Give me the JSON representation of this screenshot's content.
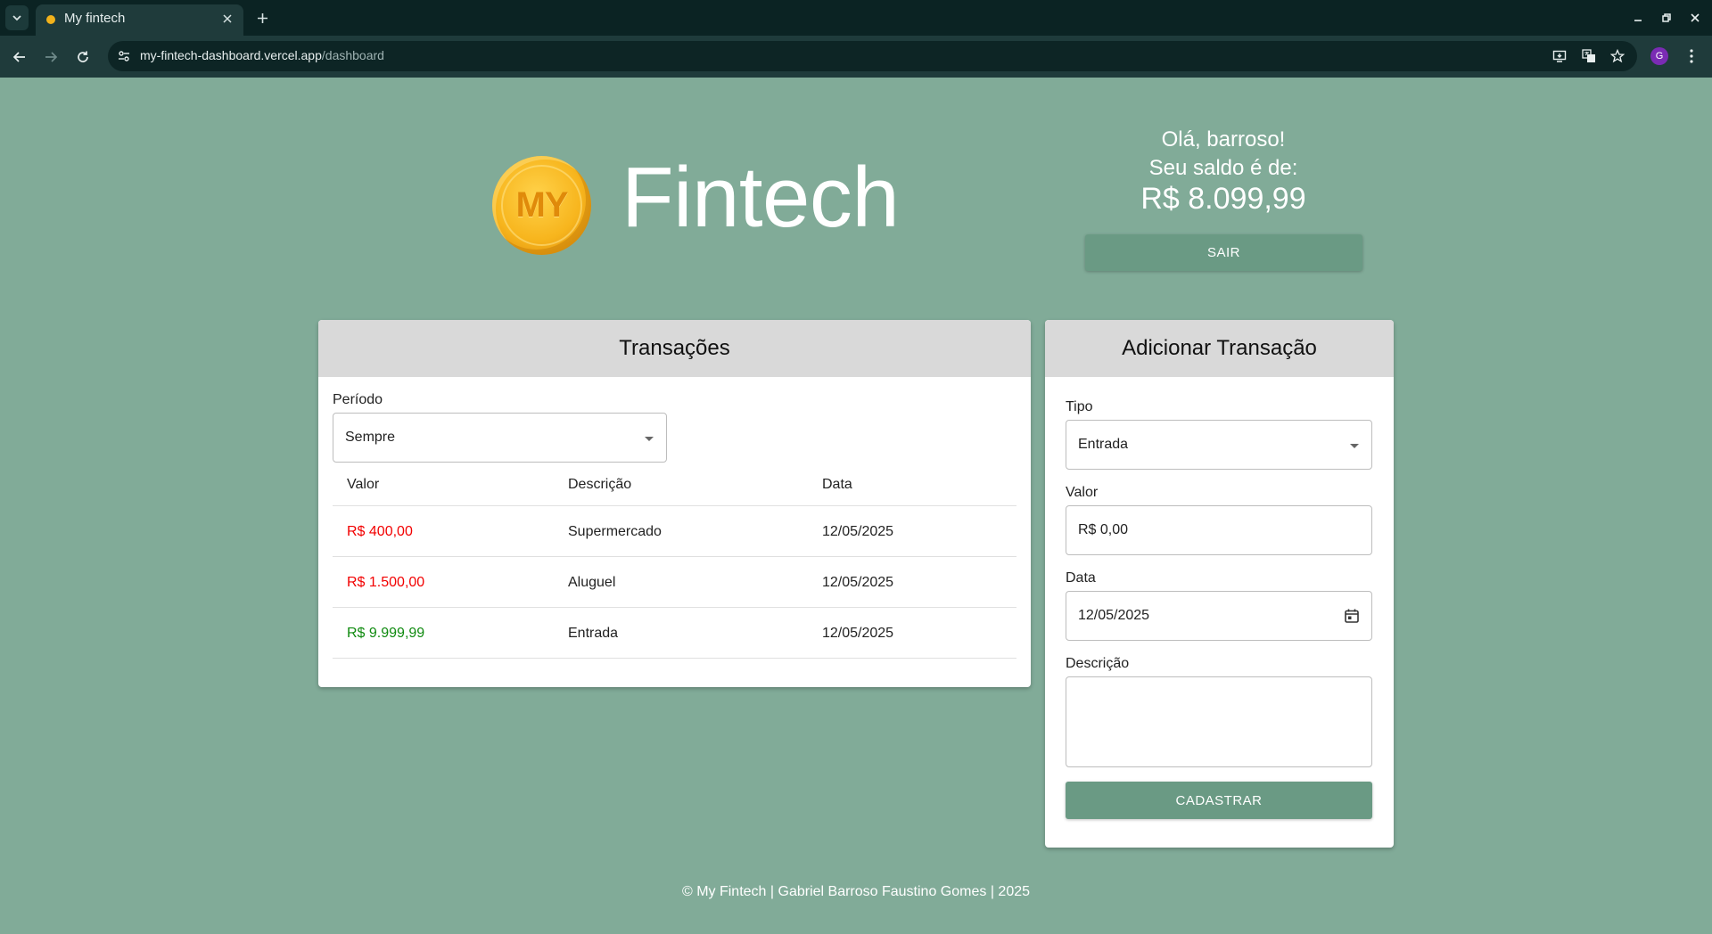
{
  "browser": {
    "tab_title": "My fintech",
    "url_host": "my-fintech-dashboard.vercel.app",
    "url_path": "/dashboard",
    "profile_initial": "G"
  },
  "header": {
    "coin_text": "MY",
    "brand": "Fintech",
    "greeting": "Olá, barroso!",
    "balance_label": "Seu saldo é de:",
    "balance": "R$ 8.099,99",
    "logout_label": "SAIR"
  },
  "transactions": {
    "title": "Transações",
    "period_label": "Período",
    "period_value": "Sempre",
    "columns": [
      "Valor",
      "Descrição",
      "Data"
    ],
    "rows": [
      {
        "value": "R$ 400,00",
        "description": "Supermercado",
        "date": "12/05/2025",
        "kind": "neg"
      },
      {
        "value": "R$ 1.500,00",
        "description": "Aluguel",
        "date": "12/05/2025",
        "kind": "neg"
      },
      {
        "value": "R$ 9.999,99",
        "description": "Entrada",
        "date": "12/05/2025",
        "kind": "pos"
      }
    ]
  },
  "add": {
    "title": "Adicionar Transação",
    "type_label": "Tipo",
    "type_value": "Entrada",
    "value_label": "Valor",
    "value_value": "R$ 0,00",
    "date_label": "Data",
    "date_value": "12/05/2025",
    "desc_label": "Descrição",
    "submit_label": "CADASTRAR"
  },
  "footer": "© My Fintech | Gabriel Barroso Faustino Gomes | 2025",
  "colors": {
    "background": "#81ab98",
    "button": "#6a9a84",
    "negative": "#f20000",
    "positive": "#0f8a0f"
  }
}
